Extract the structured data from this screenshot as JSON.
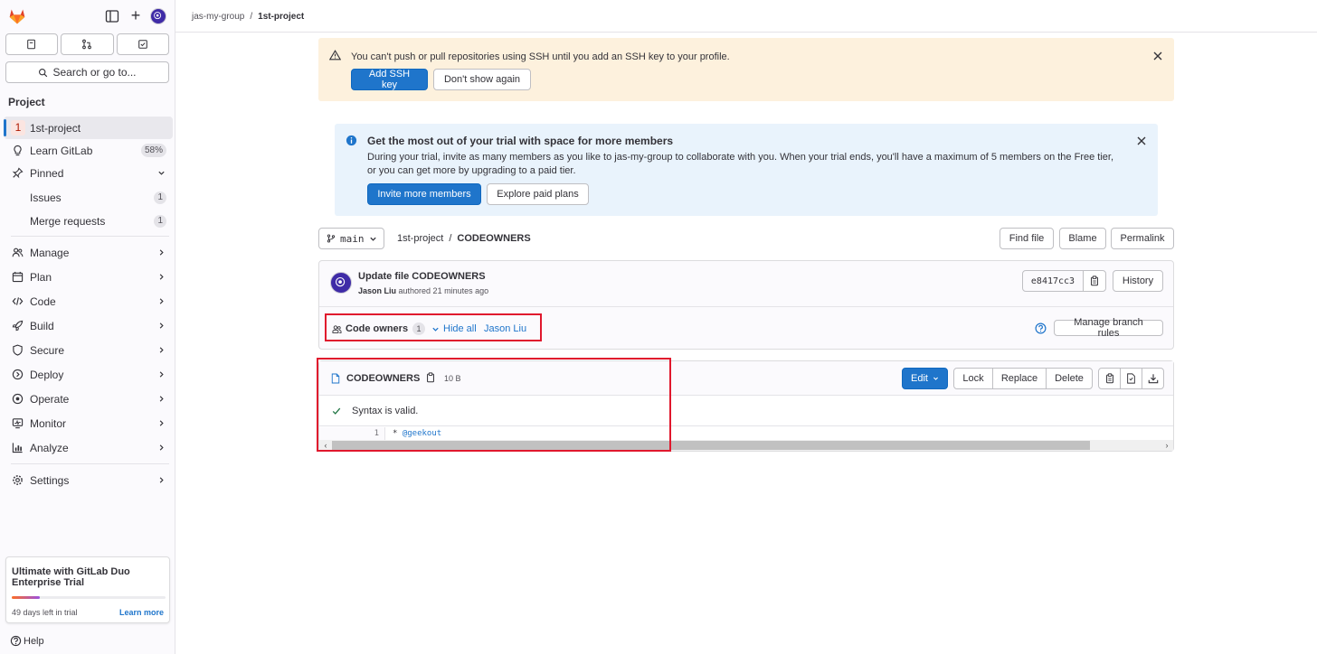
{
  "breadcrumb": {
    "group": "jas-my-group",
    "project": "1st-project"
  },
  "sidebar": {
    "search_label": "Search or go to...",
    "section_heading": "Project",
    "project_badge": "1",
    "items": {
      "project": "1st-project",
      "learn": "Learn GitLab",
      "learn_pct": "58%",
      "pinned": "Pinned",
      "issues": "Issues",
      "issues_count": "1",
      "merge_requests": "Merge requests",
      "merge_requests_count": "1",
      "manage": "Manage",
      "plan": "Plan",
      "code": "Code",
      "build": "Build",
      "secure": "Secure",
      "deploy": "Deploy",
      "operate": "Operate",
      "monitor": "Monitor",
      "analyze": "Analyze",
      "settings": "Settings"
    },
    "trial": {
      "title": "Ultimate with GitLab Duo Enterprise Trial",
      "progress": 0.18,
      "days_left": "49 days left in trial",
      "learn_more": "Learn more"
    },
    "help": "Help"
  },
  "ssh_alert": {
    "message": "You can't push or pull repositories using SSH until you add an SSH key to your profile.",
    "add_key": "Add SSH key",
    "dont_show": "Don't show again"
  },
  "trial_alert": {
    "title": "Get the most out of your trial with space for more members",
    "body": "During your trial, invite as many members as you like to jas-my-group to collaborate with you. When your trial ends, you'll have a maximum of 5 members on the Free tier, or you can get more by upgrading to a paid tier.",
    "invite": "Invite more members",
    "explore": "Explore paid plans"
  },
  "file_nav": {
    "branch": "main",
    "project": "1st-project",
    "separator": "/",
    "file": "CODEOWNERS",
    "find_file": "Find file",
    "blame": "Blame",
    "permalink": "Permalink"
  },
  "commit": {
    "title": "Update file CODEOWNERS",
    "author": "Jason Liu",
    "authored": "authored 21 minutes ago",
    "sha": "e8417cc3",
    "history": "History"
  },
  "code_owners": {
    "label": "Code owners",
    "count": "1",
    "hide_all": "Hide all",
    "owner": "Jason Liu",
    "manage_rules": "Manage branch rules"
  },
  "file": {
    "name": "CODEOWNERS",
    "size": "10 B",
    "edit": "Edit",
    "lock": "Lock",
    "replace": "Replace",
    "delete": "Delete",
    "validation": "Syntax is valid.",
    "line_number": "1",
    "line_pattern": "* ",
    "line_owner": "@geekout"
  },
  "colors": {
    "accent": "#1f75cb",
    "highlight": "#e0182d",
    "warning_bg": "#fdf1dd",
    "info_bg": "#e9f3fc"
  }
}
